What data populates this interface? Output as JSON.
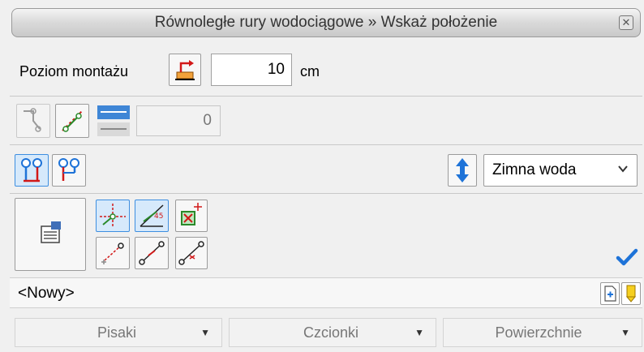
{
  "title": "Równoległe rury wodociągowe » Wskaż położenie",
  "level": {
    "label": "Poziom montażu",
    "value": "10",
    "unit": "cm"
  },
  "offset_value": "0",
  "medium": {
    "selected": "Zimna woda"
  },
  "name_field": {
    "value": "<Nowy>"
  },
  "tabs": [
    {
      "label": "Pisaki"
    },
    {
      "label": "Czcionki"
    },
    {
      "label": "Powierzchnie"
    }
  ],
  "colors": {
    "accent": "#1e73d8",
    "pipe_red": "#d21818",
    "pipe_green": "#2a8a2a",
    "check": "#1e73d8"
  }
}
